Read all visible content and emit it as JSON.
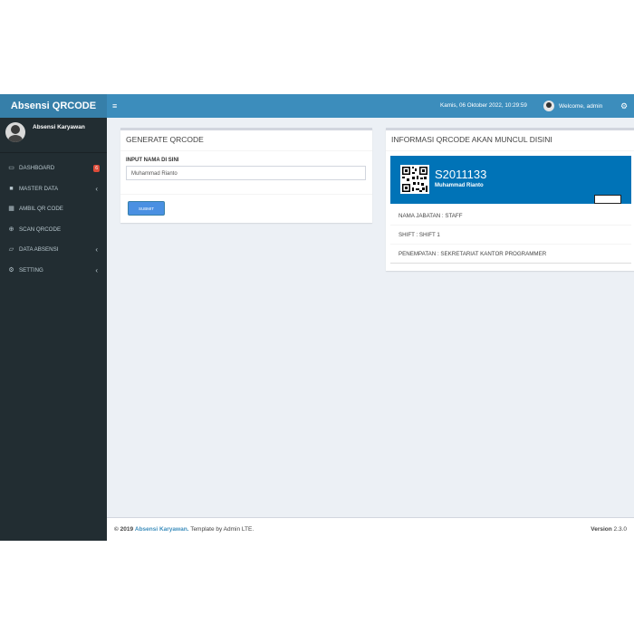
{
  "header": {
    "brand": "Absensi QRCODE",
    "menu_icon": "≡",
    "datetime": "Kamis, 06 Oktober 2022, 10:29:59",
    "welcome": "Welcome, admin",
    "settings_icon": "gears-icon"
  },
  "sidebar": {
    "user_name": "Absensi Karyawan",
    "items": [
      {
        "label": "DASHBOARD",
        "icon": "laptop-icon",
        "badge": "6"
      },
      {
        "label": "MASTER DATA",
        "icon": "folder-icon"
      },
      {
        "label": "AMBIL QR CODE",
        "icon": "qrcode-icon"
      },
      {
        "label": "SCAN QRCODE",
        "icon": "search-icon"
      },
      {
        "label": "DATA ABSENSI",
        "icon": "folder-open-icon"
      },
      {
        "label": "SETTING",
        "icon": "gears-icon"
      }
    ]
  },
  "generate": {
    "title": "GENERATE QRCODE",
    "input_label": "INPUT NAMA DI SINI",
    "input_value": "Muhammad Rianto",
    "submit_label": "SUBMIT"
  },
  "info": {
    "title": "INFORMASI QRCODE AKAN MUNCUL DISINI",
    "code": "S2011133",
    "name": "Muhammad Rianto",
    "jabatan": "NAMA JABATAN : STAFF",
    "shift": "SHIFT : SHIFT 1",
    "penempatan": "PENEMPATAN : SEKRETARIAT KANTOR PROGRAMMER"
  },
  "footer": {
    "copyright": "© 2019",
    "link": "Absensi Karyawan.",
    "template": "Template by Admin LTE.",
    "version_label": "Version",
    "version": "2.3.0"
  },
  "colors": {
    "header": "#3c8dbc",
    "logo": "#367fa9",
    "sidebar": "#222d32",
    "widget": "#0073b7",
    "badge": "#dd4b39"
  }
}
